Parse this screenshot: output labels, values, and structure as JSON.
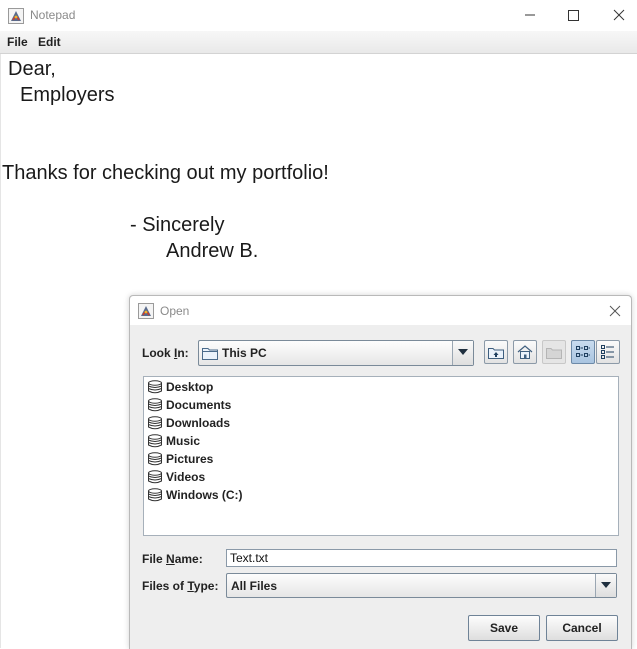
{
  "notepad": {
    "title": "Notepad",
    "menu": [
      "File",
      "Edit"
    ],
    "lines": [
      "Dear,",
      "Employers",
      "Thanks for checking out my portfolio!",
      "- Sincerely",
      "Andrew B."
    ],
    "window_controls": [
      "minimize-icon",
      "maximize-icon",
      "close-icon"
    ]
  },
  "dialog": {
    "title": "Open",
    "look_in": {
      "label_before": "Look ",
      "label_mnemonic": "I",
      "label_after": "n:",
      "value": "This PC"
    },
    "toolbar_icons": [
      "up-one-level-icon",
      "home-icon",
      "new-folder-icon",
      "list-view-icon",
      "details-view-icon"
    ],
    "items": [
      "Desktop",
      "Documents",
      "Downloads",
      "Music",
      "Pictures",
      "Videos",
      "Windows (C:)"
    ],
    "file_name": {
      "label_before": "File ",
      "label_mnemonic": "N",
      "label_after": "ame:",
      "value": "Text.txt"
    },
    "file_type": {
      "label_before": "Files of ",
      "label_mnemonic": "T",
      "label_after": "ype:",
      "value": "All Files"
    },
    "buttons": {
      "save": "Save",
      "cancel": "Cancel"
    }
  }
}
